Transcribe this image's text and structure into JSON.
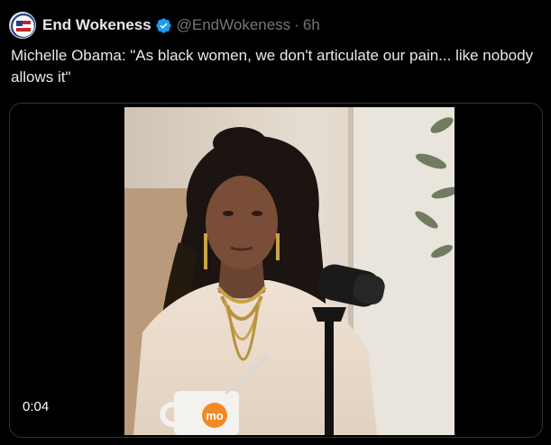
{
  "tweet": {
    "display_name": "End Wokeness",
    "handle": "@EndWokeness",
    "separator": "·",
    "time": "6h",
    "text": "Michelle Obama: \"As black women, we don't articulate our pain... like nobody allows it\""
  },
  "media": {
    "timestamp": "0:04",
    "mug_logo_text": "mo"
  },
  "icons": {
    "avatar": "end-wokeness-avatar",
    "verified": "verified-badge-icon"
  },
  "colors": {
    "background": "#000000",
    "text": "#e7e9ea",
    "muted": "#71767b",
    "verified": "#1d9bf0",
    "border": "#2f3336"
  }
}
